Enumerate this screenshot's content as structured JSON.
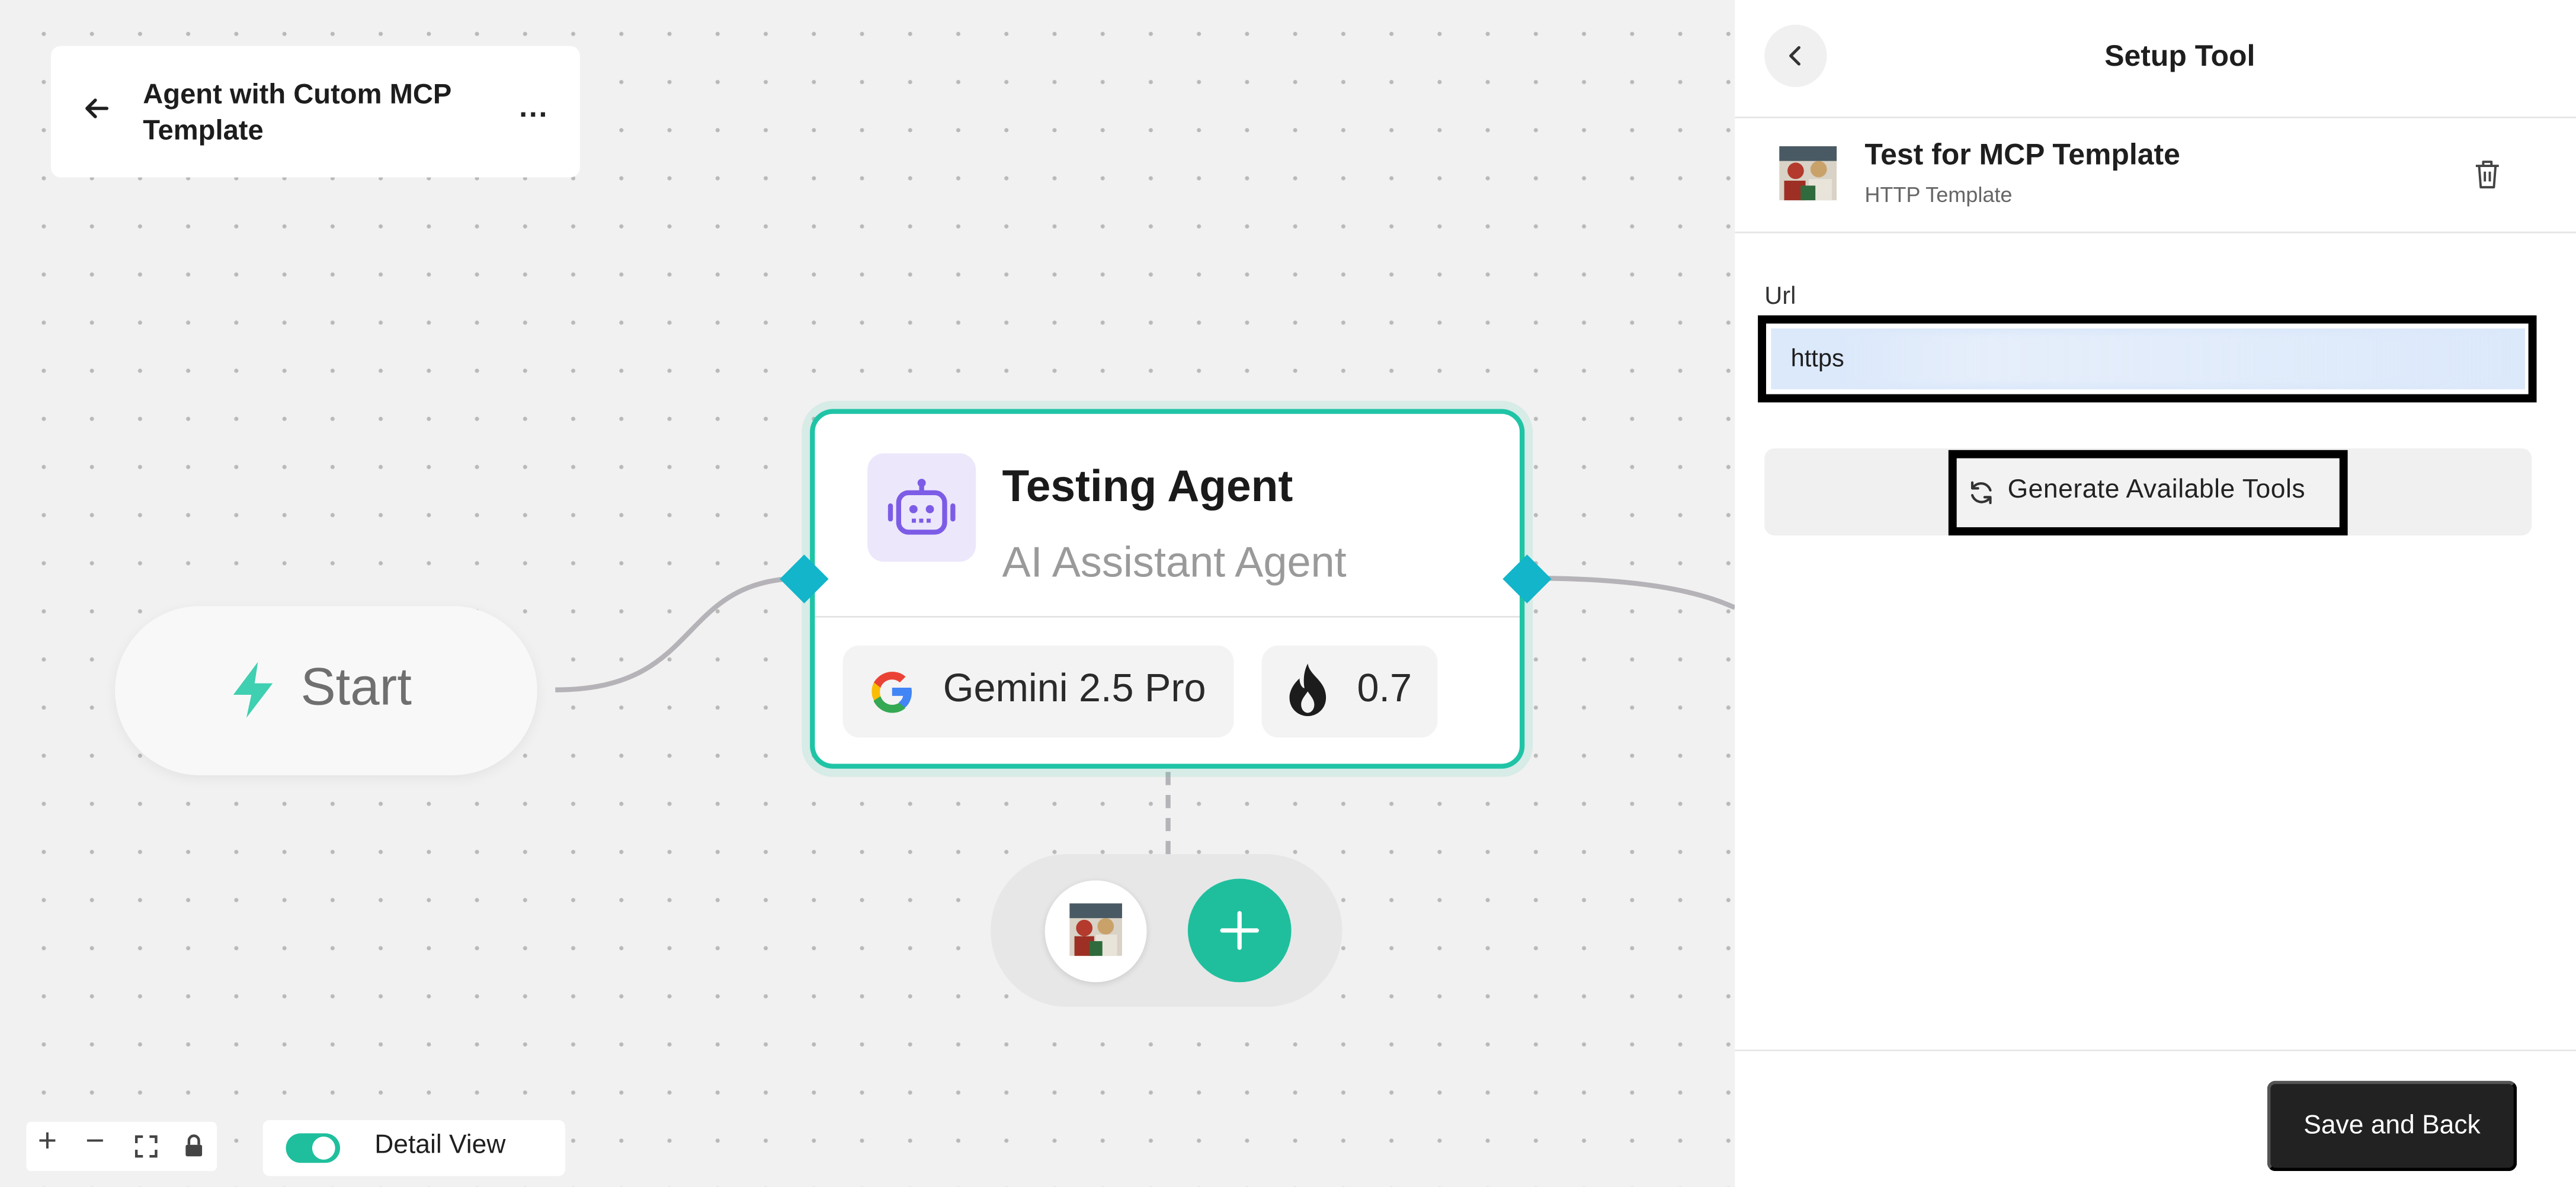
{
  "canvas": {
    "flow_title": "Agent with Cutom MCP Template",
    "more_label": "...",
    "start_node": {
      "label": "Start"
    },
    "agent_node": {
      "name": "Testing Agent",
      "type": "AI Assistant Agent",
      "model": "Gemini 2.5 Pro",
      "temperature": "0.7"
    },
    "controls": {
      "zoom_in": "+",
      "zoom_out": "−"
    },
    "detail_view": {
      "label": "Detail View",
      "enabled": true
    },
    "colors": {
      "accent": "#1fc4a6",
      "handle": "#12b5c9",
      "add_button": "#1fbf9d",
      "agent_icon": "#7c5ce6"
    }
  },
  "panel": {
    "title": "Setup Tool",
    "tool": {
      "name": "Test for MCP Template",
      "type": "HTTP Template"
    },
    "url": {
      "label": "Url",
      "value": "https"
    },
    "generate_label": "Generate Available Tools",
    "save_label": "Save and Back"
  },
  "icons": [
    "back-arrow-icon",
    "more-icon",
    "lightning-icon",
    "robot-icon",
    "google-icon",
    "flame-icon",
    "plus-icon",
    "minus-icon",
    "fit-view-icon",
    "lock-icon",
    "chevron-left-icon",
    "trash-icon",
    "refresh-icon"
  ]
}
